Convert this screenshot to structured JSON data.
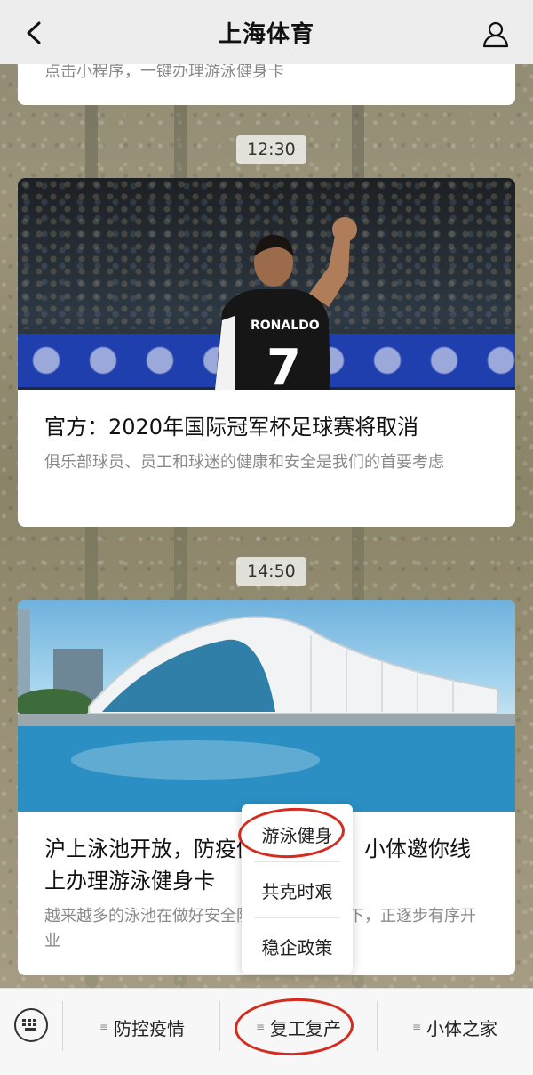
{
  "header": {
    "title": "上海体育"
  },
  "top_card": {
    "summary": "点击小程序，一键办理游泳健身卡"
  },
  "messages": [
    {
      "time": "12:30",
      "title": "官方：2020年国际冠军杯足球赛将取消",
      "desc": "俱乐部球员、员工和球迷的健康和安全是我们的首要考虑",
      "jersey_name": "RONALDO",
      "jersey_number": "7"
    },
    {
      "time": "14:50",
      "title": "沪上泳池开放，防疫健身两不误，小体邀你线上办理游泳健身卡",
      "desc": "越来越多的泳池在做好安全防疫措施的前提下，正逐步有序开业"
    }
  ],
  "popup_menu": {
    "items": [
      "游泳健身",
      "共克时艰",
      "稳企政策"
    ]
  },
  "bottom_menu": {
    "items": [
      "防控疫情",
      "复工复产",
      "小体之家"
    ]
  },
  "colors": {
    "highlight_ring": "#d52b1e",
    "header_bg": "#ededed"
  },
  "icons": [
    "back-chevron-icon",
    "profile-icon",
    "keyboard-icon",
    "menu-lines-icon"
  ]
}
